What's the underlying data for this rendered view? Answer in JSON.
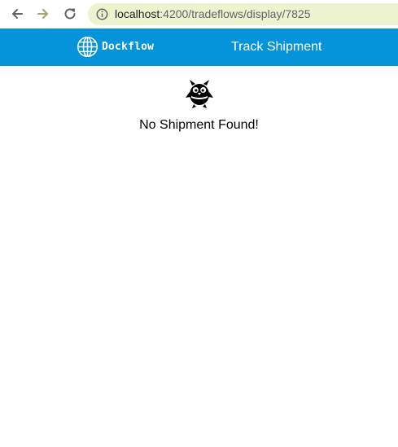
{
  "browser": {
    "back_icon": "arrow-left-icon",
    "forward_icon": "arrow-right-icon",
    "reload_icon": "reload-icon",
    "info_icon": "info-circle-icon",
    "url_host": "localhost",
    "url_rest": ":4200/tradeflows/display/7825",
    "url_highlight_color": "#eef3cf"
  },
  "header": {
    "brand_name": "Dockflow",
    "brand_icon": "globe-icon",
    "nav_link": "Track Shipment",
    "background_color": "#0593d9"
  },
  "main": {
    "empty_icon": "bird-mascot-icon",
    "empty_message": "No Shipment Found!"
  }
}
